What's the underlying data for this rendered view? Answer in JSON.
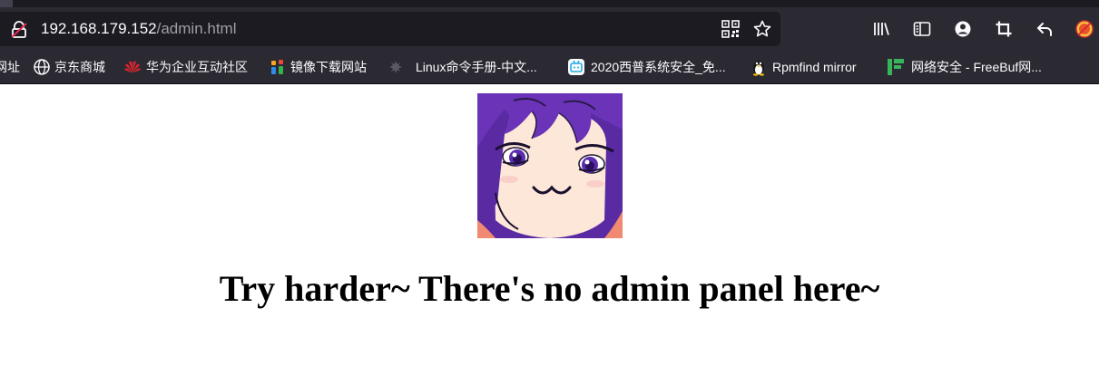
{
  "browser": {
    "url_host": "192.168.179.152",
    "url_path": "/admin.html",
    "urlbar_icons": [
      "qr-code-icon",
      "bookmark-star-icon"
    ],
    "toolbar_icons": [
      "library-icon",
      "sidebar-icon",
      "account-icon",
      "screenshot-crop-icon",
      "back-arrow-icon",
      "extension-icon"
    ]
  },
  "bookmarks": [
    {
      "label": "网址",
      "icon": "none"
    },
    {
      "label": "京东商城",
      "icon": "globe-icon"
    },
    {
      "label": "华为企业互动社区",
      "icon": "huawei-icon"
    },
    {
      "label": "镜像下载网站",
      "icon": "mirror-site-icon"
    },
    {
      "label": "Linux命令手册-中文...",
      "icon": "linux-manual-icon"
    },
    {
      "label": "2020西普系统安全_免...",
      "icon": "bilibili-icon"
    },
    {
      "label": "Rpmfind mirror",
      "icon": "tux-icon"
    },
    {
      "label": "网络安全 - FreeBuf网...",
      "icon": "freebuf-icon"
    }
  ],
  "content": {
    "heading": "Try harder~ There's no admin panel here~",
    "image": "anime-smug-face-image"
  }
}
